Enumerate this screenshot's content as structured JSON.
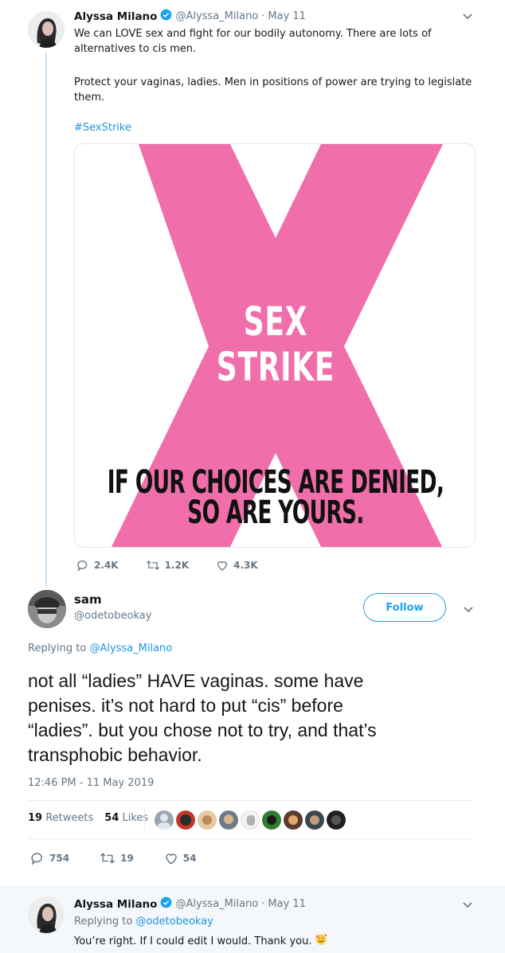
{
  "tweet1": {
    "author_name": "Alyssa Milano",
    "handle": "@Alyssa_Milano",
    "separator": "·",
    "date": "May 11",
    "line1": "We can LOVE sex and fight for our bodily autonomy. There are lots of",
    "line2": "alternatives to cis men.",
    "line3": "Protect your vaginas, ladies. Men in positions of power are trying to legislate",
    "line4": "them.",
    "hashtag": "#SexStrike",
    "image": {
      "title_line1": "SEX",
      "title_line2": "STRIKE",
      "tagline_line1": "IF OUR CHOICES ARE DENIED,",
      "tagline_line2": "SO ARE YOURS.",
      "accent_color": "#f06eaa"
    },
    "replies": "2.4K",
    "retweets": "1.2K",
    "likes": "4.3K"
  },
  "tweet2": {
    "author_name": "sam",
    "handle": "@odetobeokay",
    "follow_label": "Follow",
    "replying_prefix": "Replying to",
    "replying_to": "@Alyssa_Milano",
    "line1": "not all “ladies” HAVE vaginas. some have",
    "line2": "penises. it’s not hard to put “cis” before",
    "line3": "“ladies”. but you chose not to try, and that’s",
    "line4": "transphobic behavior.",
    "timestamp": "12:46 PM - 11 May 2019",
    "retweets_count": "19",
    "retweets_label": "Retweets",
    "likes_count": "54",
    "likes_label": "Likes",
    "replies": "754",
    "retweets": "19",
    "likes": "54"
  },
  "tweet3": {
    "author_name": "Alyssa Milano",
    "handle": "@Alyssa_Milano",
    "separator": "·",
    "date": "May 11",
    "replying_prefix": "Replying to",
    "replying_to": "@odetobeokay",
    "text": "You’re right. If I could edit I would. Thank you."
  },
  "colors": {
    "link": "#1b95e0",
    "muted": "#657786",
    "verified": "#1da1f2",
    "thread_line": "#cce4f5",
    "reply_bg": "#f5f8fa"
  }
}
